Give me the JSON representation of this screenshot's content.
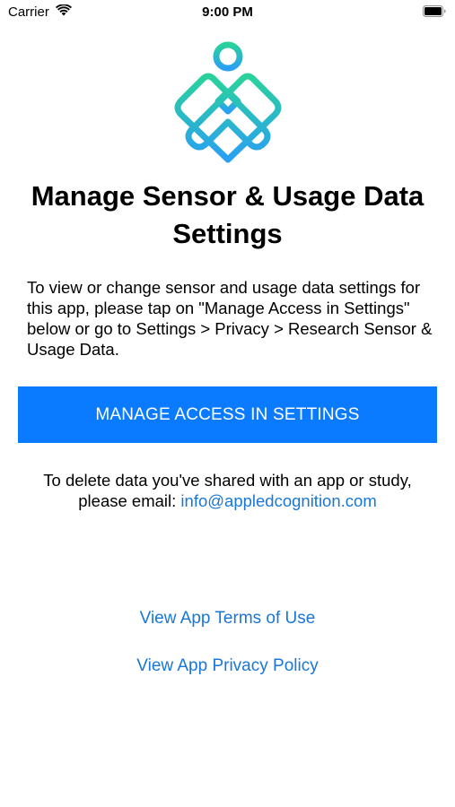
{
  "status_bar": {
    "carrier": "Carrier",
    "time": "9:00 PM",
    "icons": [
      "wifi-icon",
      "battery-icon"
    ]
  },
  "logo": {
    "icon": "app-logo-icon",
    "colors": {
      "gradient_top": "#29d29b",
      "gradient_bottom": "#2a9ff4"
    }
  },
  "title": "Manage Sensor & Usage Data Settings",
  "description": "To view or change sensor and usage data settings for this app, please tap on \"Manage Access in Settings\" below or go to Settings > Privacy > Research Sensor & Usage Data.",
  "manage_button": {
    "label": "MANAGE ACCESS IN SETTINGS",
    "color": "#0a7aff"
  },
  "delete_note": {
    "text": "To delete data you've shared with an app or study, please email: ",
    "email": "info@appledcognition.com"
  },
  "links": {
    "terms": "View App Terms of Use",
    "privacy": "View App Privacy Policy",
    "color": "#1877d8"
  }
}
